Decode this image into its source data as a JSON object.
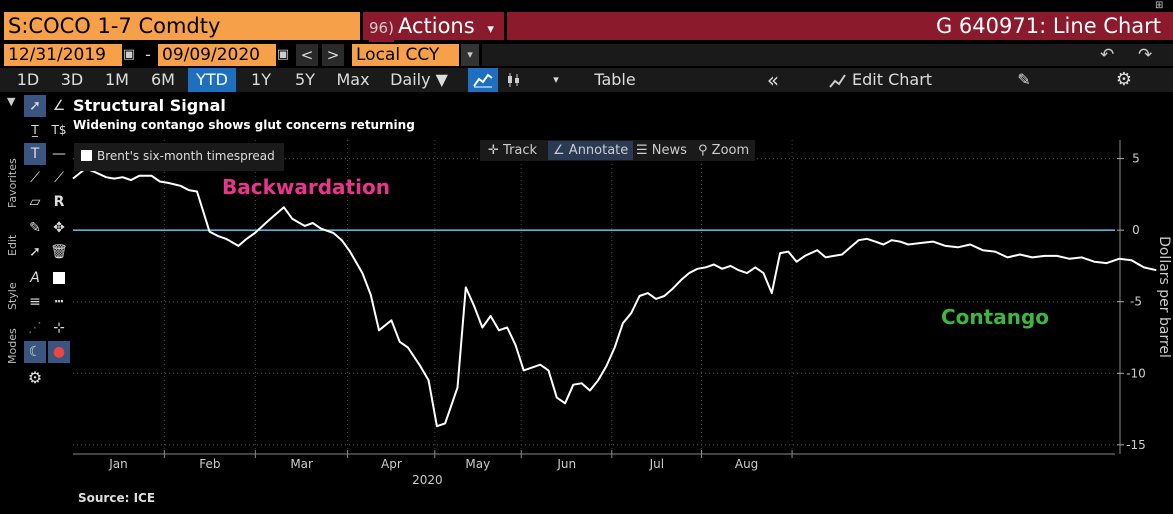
{
  "header": {
    "security": "S:COCO 1-7 Comdty",
    "actions_num": "96)",
    "actions_label": "Actions",
    "actions_arrow": "▾",
    "window_title": "G 640971: Line Chart"
  },
  "dates": {
    "start": "12/31/2019",
    "dash": "-",
    "end": "09/09/2020",
    "prev": "<",
    "next": ">",
    "currency": "Local CCY",
    "currency_arrow": "▾"
  },
  "top_icons": {
    "undo": "↶",
    "redo": "↷"
  },
  "toolbar": {
    "periods": [
      "1D",
      "3D",
      "1M",
      "6M",
      "YTD",
      "1Y",
      "5Y",
      "Max"
    ],
    "active_period": "YTD",
    "frequency": "Daily ▼",
    "table": "Table",
    "collapse": "«",
    "edit_chart": "Edit Chart",
    "dropdown": "▾"
  },
  "side_tabs": [
    "Favorites",
    "Edit",
    "Style",
    "Modes"
  ],
  "chart_tools": {
    "track": "Track",
    "annotate": "Annotate",
    "news": "News",
    "zoom": "Zoom"
  },
  "chart_data": {
    "type": "line",
    "title": "Structural Signal",
    "subtitle": "Widening contango shows glut concerns returning",
    "legend": "Brent's six-month timespread",
    "ylabel": "Dollars per barrel",
    "year_label": "2020",
    "months": [
      "Jan",
      "Feb",
      "Mar",
      "Apr",
      "May",
      "Jun",
      "Jul",
      "Aug"
    ],
    "yticks": [
      5,
      0,
      -5,
      -10,
      -15
    ],
    "ylim": [
      -15.5,
      6.3
    ],
    "xlim": [
      0,
      252
    ],
    "zero_line_color": "#5ab4e0",
    "line_color": "#ffffff",
    "annotations": [
      {
        "text": "Backwardation",
        "color": "#e8368f"
      },
      {
        "text": "Contango",
        "color": "#3db83d"
      }
    ],
    "source": "Source: ICE",
    "x": [
      0,
      3,
      5,
      8,
      10,
      12,
      14,
      16,
      19,
      21,
      23,
      26,
      28,
      30,
      33,
      35,
      37,
      40,
      42,
      44,
      47,
      49,
      51,
      53,
      56,
      58,
      60,
      63,
      65,
      67,
      70,
      72,
      74,
      77,
      79,
      81,
      84,
      86,
      88,
      90,
      93,
      95,
      97,
      99,
      101,
      103,
      105,
      107,
      109,
      111,
      113,
      115,
      117,
      119,
      121,
      123,
      125,
      127,
      129,
      131,
      133,
      135,
      137,
      139,
      141,
      143,
      145,
      147,
      149,
      151,
      153,
      155,
      157,
      159,
      161,
      163,
      165,
      167,
      169,
      171,
      173,
      175,
      177,
      180,
      182,
      184,
      186,
      188,
      190,
      192,
      194,
      196,
      198,
      200,
      202,
      205,
      208,
      211,
      214,
      217,
      220,
      223,
      226,
      229,
      232,
      235,
      238,
      241,
      244,
      247,
      250,
      253,
      256,
      259,
      262
    ],
    "y": [
      3.6,
      4.3,
      4.1,
      3.7,
      3.6,
      3.7,
      3.5,
      3.8,
      3.8,
      3.4,
      3.3,
      3.1,
      2.8,
      2.7,
      -0.1,
      -0.4,
      -0.6,
      -1.1,
      -0.6,
      -0.2,
      0.6,
      1.1,
      1.6,
      0.8,
      0.3,
      0.5,
      0.1,
      -0.2,
      -0.7,
      -1.5,
      -3.0,
      -4.5,
      -7.0,
      -6.3,
      -7.8,
      -8.2,
      -9.5,
      -10.5,
      -13.7,
      -13.5,
      -11.0,
      -4.0,
      -5.3,
      -6.8,
      -6.0,
      -7.0,
      -6.8,
      -8.0,
      -9.8,
      -9.6,
      -9.4,
      -9.8,
      -11.7,
      -12.1,
      -10.8,
      -10.7,
      -11.2,
      -10.5,
      -9.5,
      -8.2,
      -6.5,
      -5.8,
      -4.6,
      -4.4,
      -4.8,
      -4.6,
      -4.1,
      -3.5,
      -3.0,
      -2.7,
      -2.6,
      -2.4,
      -2.7,
      -2.5,
      -2.8,
      -3.0,
      -2.6,
      -3.0,
      -4.4,
      -1.6,
      -1.5,
      -2.2,
      -1.8,
      -1.4,
      -1.9,
      -1.8,
      -1.7,
      -1.2,
      -0.7,
      -0.6,
      -0.8,
      -1.0,
      -0.7,
      -0.8,
      -1.0,
      -0.9,
      -0.8,
      -1.1,
      -1.2,
      -1.0,
      -1.4,
      -1.5,
      -1.9,
      -1.7,
      -1.9,
      -1.8,
      -1.8,
      -2.0,
      -1.9,
      -2.2,
      -2.3,
      -2.0,
      -2.1,
      -2.6,
      -2.8
    ]
  }
}
